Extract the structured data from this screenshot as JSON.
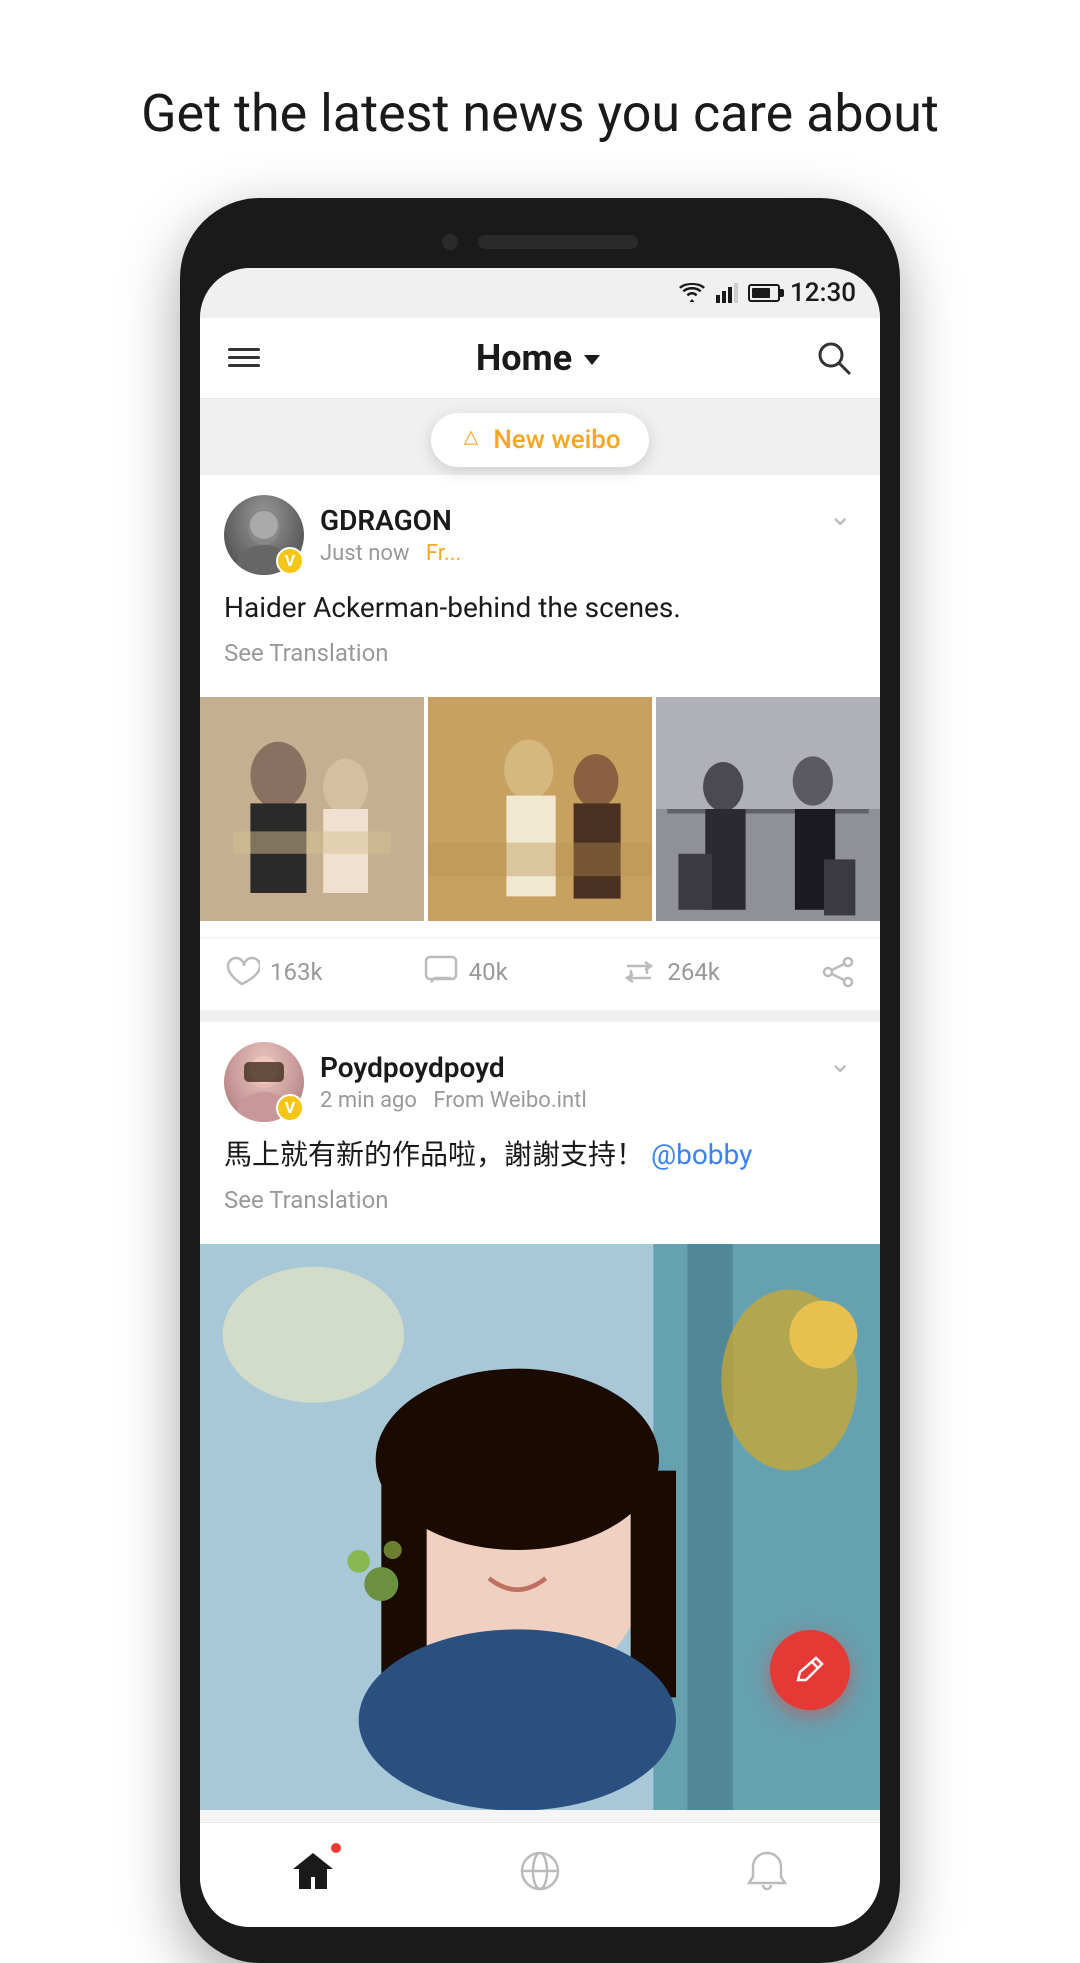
{
  "headline": "Get the latest news you care about",
  "statusBar": {
    "time": "12:30"
  },
  "header": {
    "title": "Home",
    "menuLabel": "menu",
    "searchLabel": "search"
  },
  "newWeiboBanner": {
    "text": "New weibo"
  },
  "posts": [
    {
      "id": "post1",
      "username": "GDRAGON",
      "time": "Just now",
      "from": "Fr...",
      "text": "Haider Ackerman-behind the scenes.",
      "seeTranslation": "See Translation",
      "likes": "163k",
      "comments": "40k",
      "reposts": "264k",
      "hasImages": true,
      "imageCount": 3
    },
    {
      "id": "post2",
      "username": "Poydpoydpoyd",
      "time": "2 min ago",
      "from": "From Weibo.intl",
      "text": "馬上就有新的作品啦，謝謝支持！",
      "mention": "@bobby",
      "seeTranslation": "See Translation",
      "hasImage": true
    }
  ],
  "nav": {
    "home": "home",
    "discover": "discover",
    "notifications": "notifications"
  },
  "fab": {
    "label": "compose"
  }
}
